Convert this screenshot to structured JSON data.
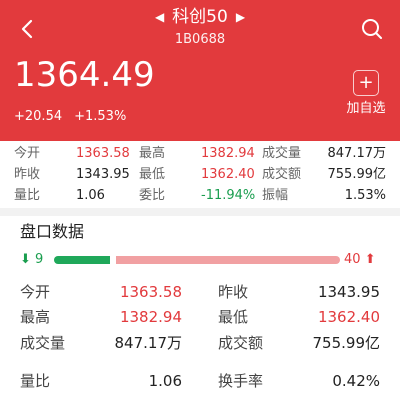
{
  "header": {
    "title": "科创50",
    "code": "1B0688",
    "price": "1364.49",
    "change": "+20.54",
    "change_pct": "+1.53%",
    "add_watch_label": "加自选",
    "colors": {
      "header_bg": "#e23a3d",
      "text": "#ffffff"
    },
    "icons": [
      "back-arrow-icon",
      "dropdown-left-icon",
      "dropdown-right-icon",
      "search-icon",
      "plus-icon"
    ]
  },
  "stats": {
    "rows": [
      [
        {
          "label": "今开",
          "value": "1363.58",
          "tone": "red"
        },
        {
          "label": "最高",
          "value": "1382.94",
          "tone": "red"
        },
        {
          "label": "成交量",
          "value": "847.17万",
          "tone": "dark"
        }
      ],
      [
        {
          "label": "昨收",
          "value": "1343.95",
          "tone": "dark"
        },
        {
          "label": "最低",
          "value": "1362.40",
          "tone": "red"
        },
        {
          "label": "成交额",
          "value": "755.99亿",
          "tone": "dark"
        }
      ],
      [
        {
          "label": "量比",
          "value": "1.06",
          "tone": "dark"
        },
        {
          "label": "委比",
          "value": "-11.94%",
          "tone": "green"
        },
        {
          "label": "振幅",
          "value": "1.53%",
          "tone": "dark"
        }
      ]
    ]
  },
  "panel": {
    "title": "盘口数据",
    "down_count": "9",
    "up_count": "40",
    "down_fraction": 0.18,
    "up_fraction": 0.82,
    "colors": {
      "down": "#1fa85a",
      "up": "#e23a3d",
      "up_bar": "#f1a0a2"
    },
    "rows": [
      [
        {
          "label": "今开",
          "value": "1363.58",
          "tone": "red"
        },
        {
          "label": "昨收",
          "value": "1343.95",
          "tone": "dark"
        }
      ],
      [
        {
          "label": "最高",
          "value": "1382.94",
          "tone": "red"
        },
        {
          "label": "最低",
          "value": "1362.40",
          "tone": "red"
        }
      ],
      [
        {
          "label": "成交量",
          "value": "847.17万",
          "tone": "dark"
        },
        {
          "label": "成交额",
          "value": "755.99亿",
          "tone": "dark"
        }
      ],
      [
        {
          "label": "量比",
          "value": "1.06",
          "tone": "dark"
        },
        {
          "label": "换手率",
          "value": "0.42%",
          "tone": "dark"
        }
      ]
    ]
  }
}
